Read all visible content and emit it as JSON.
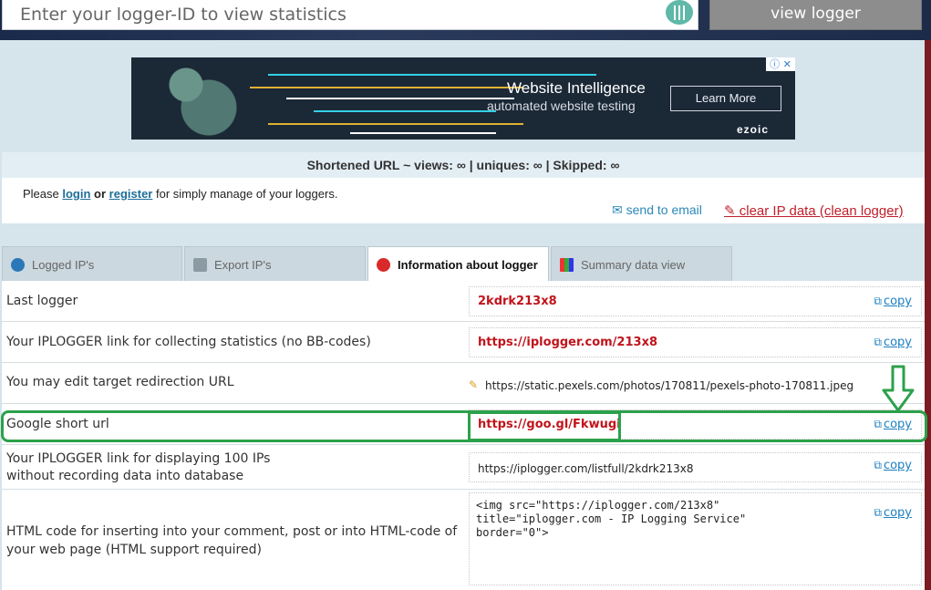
{
  "search": {
    "placeholder": "Enter your logger-ID to view statistics",
    "button_label": "view logger"
  },
  "ad": {
    "title": "Website Intelligence",
    "subtitle": "automated website testing",
    "button": "Learn More",
    "brand": "ezoic",
    "icons": "ⓘ ✕"
  },
  "stats": {
    "text": "Shortened URL ~ views: ∞ | uniques: ∞ | Skipped: ∞"
  },
  "login": {
    "prefix": "Please",
    "login_link": "login",
    "or": "or",
    "register_link": "register",
    "suffix": "for simply manage of your loggers.",
    "send_email": "send to email",
    "clear_ip": "clear IP data (clean logger)"
  },
  "tabs": [
    {
      "label": "Logged IP's"
    },
    {
      "label": "Export IP's"
    },
    {
      "label": "Information about logger"
    },
    {
      "label": "Summary data view"
    }
  ],
  "rows": [
    {
      "label": "Last logger",
      "value": "2kdrk213x8",
      "copy": "copy"
    },
    {
      "label": "Your IPLOGGER link for collecting statistics (no BB-codes)",
      "value": "https://iplogger.com/213x8",
      "copy": "copy"
    },
    {
      "label": "You may edit target redirection URL",
      "value": "https://static.pexels.com/photos/170811/pexels-photo-170811.jpeg"
    },
    {
      "label": "Google short url",
      "value": "https://goo.gl/Fkwugi",
      "copy": "copy"
    },
    {
      "label_line1": "Your IPLOGGER link for displaying 100 IPs",
      "label_line2": "without recording data into database",
      "value": "https://iplogger.com/listfull/2kdrk213x8",
      "copy": "copy"
    },
    {
      "label_line1": "HTML code for inserting into your comment, post or into HTML-code of",
      "label_line2": "your web page (HTML support required)",
      "value": "<img src=\"https://iplogger.com/213x8\"\ntitle=\"iplogger.com - IP Logging Service\"\nborder=\"0\">",
      "copy": "copy"
    }
  ],
  "colors": {
    "accent": "#2ca14b",
    "link": "#1b7fc0",
    "danger": "#c0141b"
  }
}
